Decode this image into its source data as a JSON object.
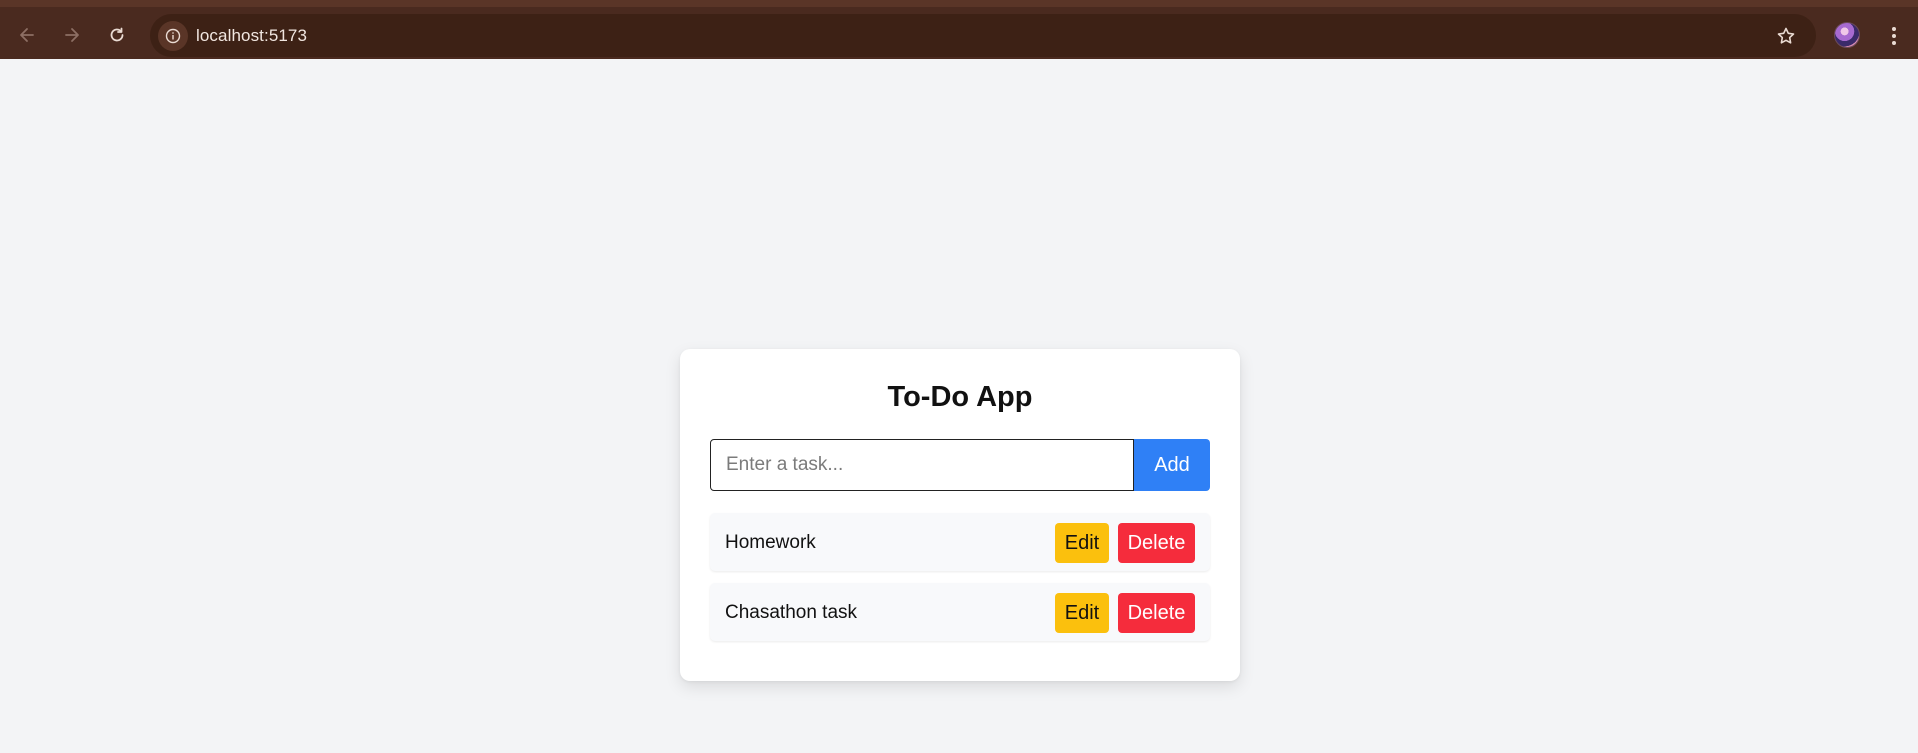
{
  "browser": {
    "url": "localhost:5173",
    "icons": {
      "back": "arrow-left-icon",
      "forward": "arrow-right-icon",
      "reload": "reload-icon",
      "site_info": "info-icon",
      "bookmark": "star-icon",
      "profile": "avatar",
      "menu": "kebab-menu-icon"
    },
    "colors": {
      "toolbar": "#4a2a1f",
      "omnibox": "#3d2115"
    }
  },
  "app": {
    "title": "To-Do App",
    "input": {
      "placeholder": "Enter a task...",
      "value": ""
    },
    "add_label": "Add",
    "tasks": [
      {
        "text": "Homework",
        "edit_label": "Edit",
        "delete_label": "Delete"
      },
      {
        "text": "Chasathon task",
        "edit_label": "Edit",
        "delete_label": "Delete"
      }
    ],
    "colors": {
      "add": "#2f80f6",
      "edit": "#fbc00d",
      "delete": "#f52c3c",
      "background": "#f3f4f6"
    }
  }
}
